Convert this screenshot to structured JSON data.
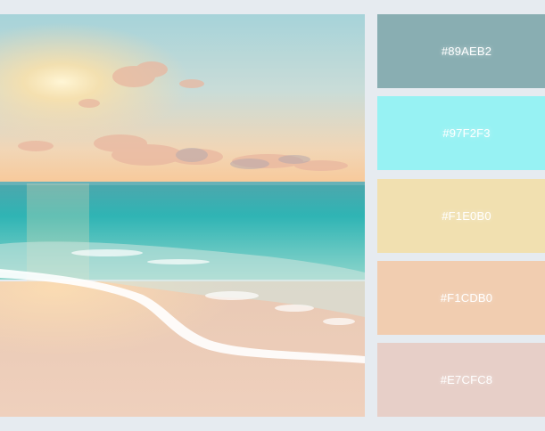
{
  "palette": [
    {
      "hex": "#89AEB2",
      "label": "#89AEB2"
    },
    {
      "hex": "#97F2F3",
      "label": "#97F2F3"
    },
    {
      "hex": "#F1E0B0",
      "label": "#F1E0B0"
    },
    {
      "hex": "#F1CDB0",
      "label": "#F1CDB0"
    },
    {
      "hex": "#E7CFC8",
      "label": "#E7CFC8"
    }
  ],
  "colors": {
    "background": "#e6ebf0",
    "sky_top": "#a9d6dc",
    "sky_horizon": "#f7d3a8",
    "sun": "#fff2c6",
    "sea": "#3fb8b8",
    "sand": "#f0d2bd",
    "foam": "#ffffff"
  }
}
